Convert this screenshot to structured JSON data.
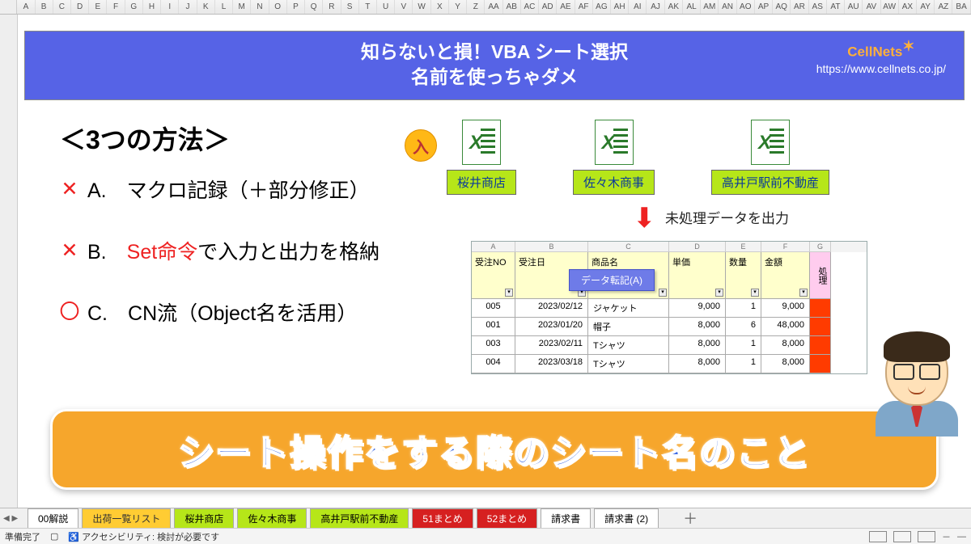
{
  "columns": [
    "A",
    "B",
    "C",
    "D",
    "E",
    "F",
    "G",
    "H",
    "I",
    "J",
    "K",
    "L",
    "M",
    "N",
    "O",
    "P",
    "Q",
    "R",
    "S",
    "T",
    "U",
    "V",
    "W",
    "X",
    "Y",
    "Z",
    "AA",
    "AB",
    "AC",
    "AD",
    "AE",
    "AF",
    "AG",
    "AH",
    "AI",
    "AJ",
    "AK",
    "AL",
    "AM",
    "AN",
    "AO",
    "AP",
    "AQ",
    "AR",
    "AS",
    "AT",
    "AU",
    "AV",
    "AW",
    "AX",
    "AY",
    "AZ",
    "BA"
  ],
  "banner": {
    "line1": "知らないと損！VBA シート選択",
    "line2": "名前を使っちゃダメ",
    "brand": "CellNets",
    "url": "https://www.cellnets.co.jp/"
  },
  "methods": {
    "title": "＜3つの方法＞",
    "a": {
      "mark": "✕",
      "label": "A.",
      "text1": "マクロ記録（＋部分修正）"
    },
    "b": {
      "mark": "✕",
      "label": "B.",
      "red": "Set命令",
      "text2": "で入力と出力を格納"
    },
    "c": {
      "mark": "〇",
      "label": "C.",
      "text1": "CN流（Object名を活用）"
    }
  },
  "badge_in": "入",
  "files": {
    "f1": "桜井商店",
    "f2": "佐々木商事",
    "f3": "高井戸駅前不動産"
  },
  "arrow_text": "未処理データを出力",
  "mini": {
    "cols": [
      "A",
      "B",
      "C",
      "D",
      "E",
      "F",
      "G"
    ],
    "headers": {
      "no": "受注NO",
      "date": "受注日",
      "name": "商品名",
      "price": "単価",
      "qty": "数量",
      "amt": "金額",
      "proc": "処理"
    },
    "button": "データ転記(A)",
    "rows": [
      {
        "no": "005",
        "date": "2023/02/12",
        "name": "ジャケット",
        "price": "9,000",
        "qty": "1",
        "amt": "9,000"
      },
      {
        "no": "001",
        "date": "2023/01/20",
        "name": "帽子",
        "price": "8,000",
        "qty": "6",
        "amt": "48,000"
      },
      {
        "no": "003",
        "date": "2023/02/11",
        "name": "Tシャツ",
        "price": "8,000",
        "qty": "1",
        "amt": "8,000"
      },
      {
        "no": "004",
        "date": "2023/03/18",
        "name": "Tシャツ",
        "price": "8,000",
        "qty": "1",
        "amt": "8,000"
      }
    ]
  },
  "big_caption": "シート操作をする際のシート名のこと",
  "tabs": {
    "t0": "00解説",
    "t1": "出荷一覧リスト",
    "t2": "桜井商店",
    "t3": "佐々木商事",
    "t4": "高井戸駅前不動産",
    "t5": "51まとめ",
    "t6": "52まとめ",
    "t7": "請求書",
    "t8": "請求書 (2)",
    "add": "＋"
  },
  "status": {
    "ready": "準備完了",
    "acc_label": "アクセシビリティ: 検討が必要です",
    "acc_icon": "♿"
  }
}
